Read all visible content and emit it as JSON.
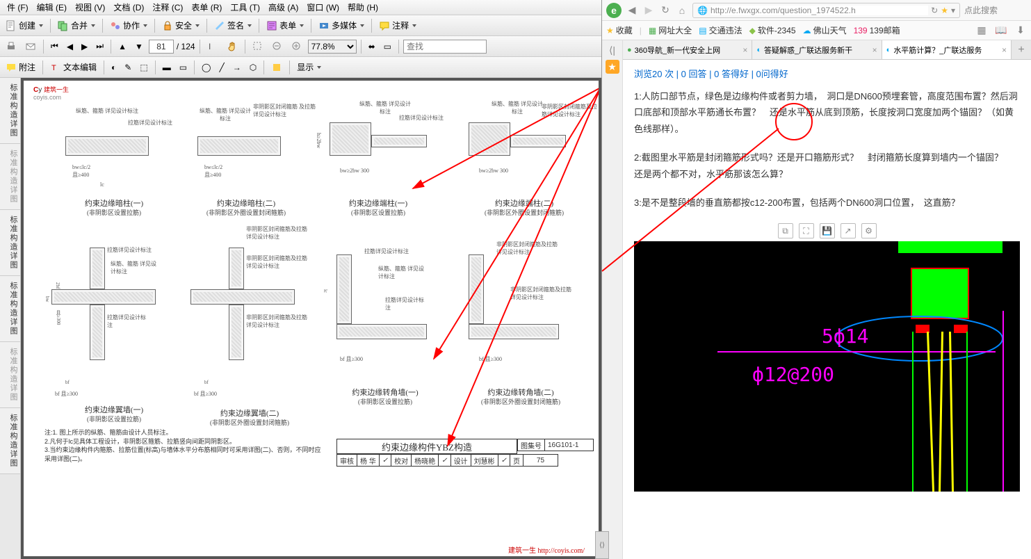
{
  "menu": [
    "件 (F)",
    "编辑 (E)",
    "视图 (V)",
    "文档 (D)",
    "注释 (C)",
    "表单 (R)",
    "工具 (T)",
    "高级 (A)",
    "窗口 (W)",
    "帮助 (H)"
  ],
  "toolbar1": {
    "create": "创建",
    "merge": "合并",
    "collab": "协作",
    "secure": "安全",
    "sign": "签名",
    "forms": "表单",
    "multimedia": "多媒体",
    "comment": "注释"
  },
  "toolbar2": {
    "page_current": "81",
    "page_total": "/ 124",
    "zoom": "77.8%",
    "find_placeholder": "查找"
  },
  "toolbar3": {
    "attach": "附注",
    "text_edit": "文本编辑",
    "show": "显示"
  },
  "sidebar": [
    "标准构造详图",
    "标准构造详图",
    "标准构造详图",
    "标准构造详图",
    "标准构造详图",
    "标准构造详图"
  ],
  "doc": {
    "logo_brand": "建筑一生",
    "logo_site": "coyis.com",
    "d1": "约束边缘暗柱(一)",
    "d1s": "(非阴影区设置拉筋)",
    "d2": "约束边缘暗柱(二)",
    "d2s": "(非阴影区外圈设置封闭箍筋)",
    "d3": "约束边缘端柱(一)",
    "d3s": "(非阴影区设置拉筋)",
    "d4": "约束边缘端柱(二)",
    "d4s": "(非阴影区外圈设置封闭箍筋)",
    "d5": "约束边缘翼墙(一)",
    "d5s": "(非阴影区设置拉筋)",
    "d6": "约束边缘翼墙(二)",
    "d6s": "(非阴影区外圈设置封闭箍筋)",
    "d7": "约束边缘转角墙(一)",
    "d7s": "(非阴影区设置拉筋)",
    "d8": "约束边缘转角墙(二)",
    "d8s": "(非阴影区外圈设置封闭箍筋)",
    "ann1": "纵筋、箍筋 详见设计标注",
    "ann2": "拉筋详见设计标注",
    "ann3": "非阴影区封闭箍筋 及拉筋详见设计标注",
    "ann4": "非阴影区封闭箍筋及拉筋详见设计标注",
    "dm1": "bw≤lc/2",
    "dm2": "且≥400",
    "dm3": "lc",
    "dm4": "bw≥2bw  300",
    "dm5": "bf  且≥300",
    "dm6": "2bf  且≥300",
    "dm7": "h≥2bw",
    "notes1": "注:1. 图上所示的纵筋、箍筋由设计人员标注。",
    "notes2": "2.凡何于lc见具体工程设计，非阴影区箍筋、拉筋竖向间距同阴影区。",
    "notes3": "3.当约束边缘构件内箍筋、拉筋位置(标高)与墙体水平分布筋相同时可采用详图(二)、否则，不同时应采用详图(二)。",
    "title_main": "约束边缘构件YBZ构造",
    "title_atlas_label": "图集号",
    "title_atlas": "16G101-1",
    "title_row_labels": {
      "review": "审核",
      "reviewer": "杨 华",
      "proof": "校对",
      "proofer": "杨晓艳",
      "design": "设计",
      "designer": "刘慧彬",
      "page_label": "页",
      "page": "75"
    },
    "footer": "建筑一生 http://coyis.com/"
  },
  "browser": {
    "url": "http://e.fwxgx.com/question_1974522.h",
    "search_hint": "点此搜索",
    "fav_label": "收藏",
    "favorites": [
      "网址大全",
      "交通违法",
      "软件-2345",
      "佛山天气",
      "139邮箱"
    ],
    "tabs": [
      {
        "label": "360导航_新一代安全上网"
      },
      {
        "label": "答疑解惑_广联达服务新干"
      },
      {
        "label": "水平筋计算？_广联达服务"
      }
    ],
    "stats": "浏览20 次 | 0 回答 | 0 答得好 | 0问得好",
    "q1": "1:人防口部节点，绿色是边缘构件或者剪力墙，　洞口是DN600预埋套管，高度范围布置？然后洞口底部和顶部水平筋通长布置？　还是水平筋从底到顶筋，长度按洞口宽度加两个锚固？（如黄色线那样）。",
    "q2": "2:截图里水平筋是封闭箍筋形式吗？还是开口箍筋形式？　封闭箍筋长度算到墙内一个锚固？　还是两个都不对，水平筋那该怎么算？",
    "q3": "3:是不是整段墙的垂直筋都按c12-200布置，包括两个DN600洞口位置，　这直筋？",
    "cad_t1": "5ф14",
    "cad_t2": "ф12@200"
  }
}
